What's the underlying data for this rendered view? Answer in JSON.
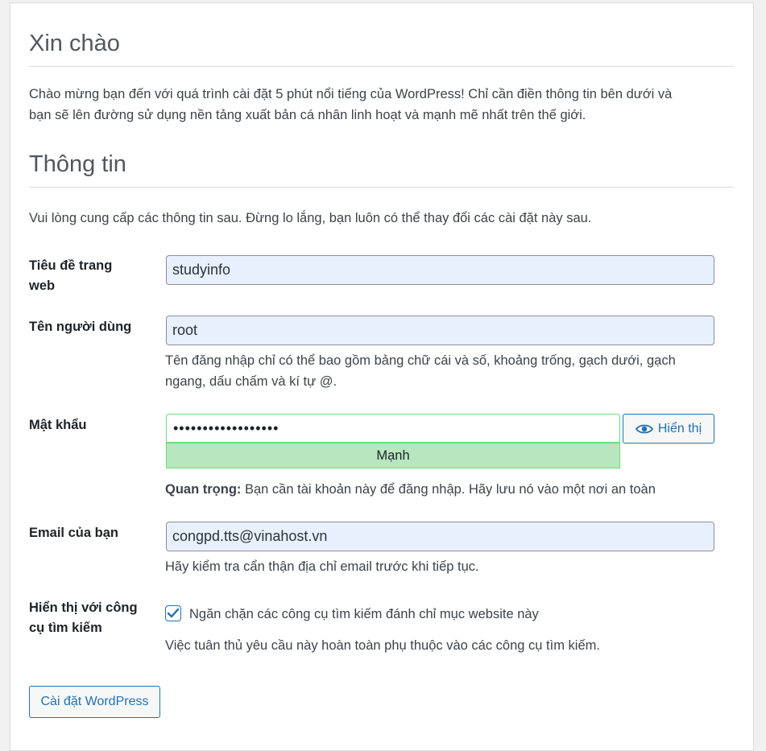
{
  "welcome": {
    "heading": "Xin chào",
    "intro_line1": "Chào mừng bạn đến với quá trình cài đặt 5 phút nổi tiếng của WordPress! Chỉ cần điền thông tin bên dưới và",
    "intro_line2": "bạn sẽ lên đường sử dụng nền tảng xuất bản cá nhân linh hoạt và mạnh mẽ nhất trên thế giới."
  },
  "info": {
    "heading": "Thông tin",
    "intro": "Vui lòng cung cấp các thông tin sau. Đừng lo lắng, bạn luôn có thể thay đổi các cài đặt này sau."
  },
  "form": {
    "site_title": {
      "label_line1": "Tiêu đề trang",
      "label_line2": "web",
      "value": "studyinfo"
    },
    "username": {
      "label": "Tên người dùng",
      "value": "root",
      "help_line1": "Tên đăng nhập chỉ có thể bao gồm bảng chữ cái và số, khoảng trống, gạch dưới, gạch",
      "help_line2": "ngang, dấu chấm và kí tự @."
    },
    "password": {
      "label": "Mật khẩu",
      "masked_value": "••••••••••••••••••",
      "strength": "Mạnh",
      "show_label": "Hiển thị",
      "important_label": "Quan trọng:",
      "important_text": " Bạn cần tài khoản này để đăng nhập. Hãy lưu nó vào một nơi an toàn",
      "strength_color": "#b8e6bf"
    },
    "email": {
      "label": "Email của bạn",
      "value": "congpd.tts@vinahost.vn",
      "help": "Hãy kiểm tra cẩn thận địa chỉ email trước khi tiếp tục."
    },
    "search_visibility": {
      "label_line1": "Hiển thị với công",
      "label_line2": "cụ tìm kiếm",
      "checkbox_label": "Ngăn chặn các công cụ tìm kiếm đánh chỉ mục website này",
      "checked": true,
      "help": "Việc tuân thủ yêu cầu này hoàn toàn phụ thuộc vào các công cụ tìm kiếm."
    }
  },
  "submit": {
    "label": "Cài đặt WordPress"
  },
  "colors": {
    "accent": "#2271b1",
    "input_bg": "#e8f0fe",
    "strong": "#68de7c"
  }
}
